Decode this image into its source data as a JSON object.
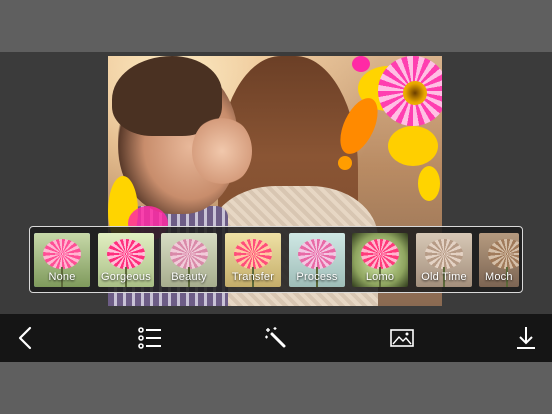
{
  "filters": [
    {
      "label": "None",
      "selected": true
    },
    {
      "label": "Gorgeous",
      "selected": false
    },
    {
      "label": "Beauty",
      "selected": false
    },
    {
      "label": "Transfer",
      "selected": false
    },
    {
      "label": "Process",
      "selected": false
    },
    {
      "label": "Lomo",
      "selected": false
    },
    {
      "label": "Old Time",
      "selected": false
    },
    {
      "label": "Moch",
      "selected": false
    }
  ],
  "toolbar": {
    "icons": [
      "back-chevron-icon",
      "list-icon",
      "magic-wand-icon",
      "image-icon",
      "download-icon"
    ]
  },
  "colors": {
    "selection": "#2a6cff",
    "toolbar_bg": "#151515",
    "stage_bg": "#3b3b3b",
    "chrome_bg": "#5f5f5f"
  }
}
